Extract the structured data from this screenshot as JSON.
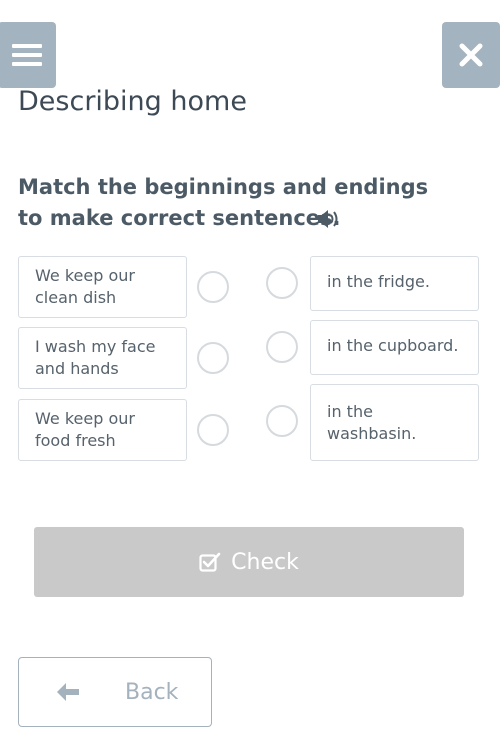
{
  "header": {
    "menu_icon": "hamburger-icon",
    "close_icon": "close-icon"
  },
  "title": "Describing home",
  "instructions": "Match the beginnings and endings to make correct sentences.",
  "audio_icon": "speaker-icon",
  "beginnings": [
    "We keep our clean dish",
    "I wash my face and hands",
    "We keep our food fresh"
  ],
  "endings": [
    "in the fridge.",
    "in the cupboard.",
    "in the washbasin."
  ],
  "check_button": {
    "label": "Check",
    "icon": "checkbox-check-icon"
  },
  "back_button": {
    "label": "Back",
    "icon": "arrow-left-icon"
  },
  "colors": {
    "accent": "#a3b3bf",
    "disabled_button": "#c9c9c9",
    "text": "#3d4a55"
  }
}
